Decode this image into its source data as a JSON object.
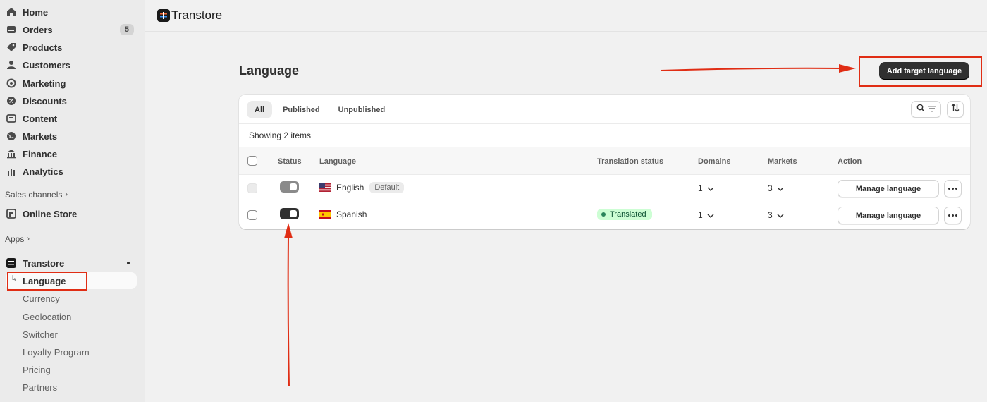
{
  "sidebar": {
    "items": [
      {
        "label": "Home",
        "icon": "home-icon"
      },
      {
        "label": "Orders",
        "icon": "orders-icon",
        "badge": "5"
      },
      {
        "label": "Products",
        "icon": "tag-icon"
      },
      {
        "label": "Customers",
        "icon": "person-icon"
      },
      {
        "label": "Marketing",
        "icon": "target-icon"
      },
      {
        "label": "Discounts",
        "icon": "discount-icon"
      },
      {
        "label": "Content",
        "icon": "content-icon"
      },
      {
        "label": "Markets",
        "icon": "globe-icon"
      },
      {
        "label": "Finance",
        "icon": "bank-icon"
      },
      {
        "label": "Analytics",
        "icon": "bar-chart-icon"
      }
    ],
    "sales_channels_label": "Sales channels",
    "online_store_label": "Online Store",
    "apps_label": "Apps",
    "app_name": "Transtore",
    "app_sub_items": [
      "Language",
      "Currency",
      "Geolocation",
      "Switcher",
      "Loyalty Program",
      "Pricing",
      "Partners"
    ]
  },
  "topbar": {
    "title": "Transtore"
  },
  "page": {
    "title": "Language",
    "primary_action": "Add target language"
  },
  "filters": {
    "tabs": [
      "All",
      "Published",
      "Unpublished"
    ],
    "active_tab": "All"
  },
  "table": {
    "showing_text": "Showing 2 items",
    "headers": {
      "status": "Status",
      "language": "Language",
      "translation_status": "Translation status",
      "domains": "Domains",
      "markets": "Markets",
      "action": "Action"
    },
    "rows": [
      {
        "language": "English",
        "flag": "us-flag",
        "default_badge": "Default",
        "published": false,
        "translation_status": "",
        "domains": "1",
        "markets": "3",
        "action": "Manage language"
      },
      {
        "language": "Spanish",
        "flag": "es-flag",
        "default_badge": "",
        "published": true,
        "translation_status": "Translated",
        "domains": "1",
        "markets": "3",
        "action": "Manage language"
      }
    ]
  },
  "colors": {
    "annotation": "#e02d14",
    "primary_button": "#303030",
    "translated_badge_bg": "#cdfed4"
  }
}
